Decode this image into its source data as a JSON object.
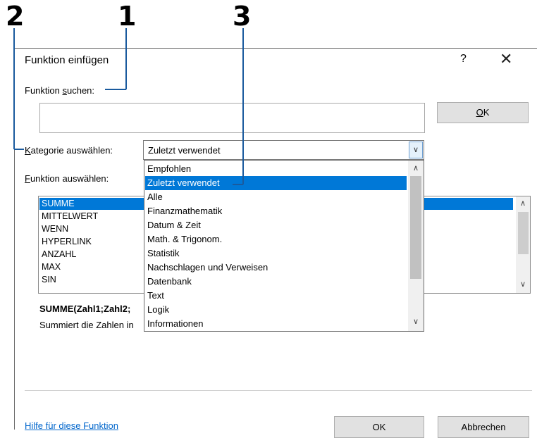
{
  "callouts": [
    "2",
    "1",
    "3"
  ],
  "dialog": {
    "title": "Funktion einfügen",
    "help": "?",
    "close": "✕"
  },
  "search": {
    "label_underlined": "s",
    "label_before": "Funktion ",
    "label_after": "uchen:",
    "value": "",
    "ok_label_underlined": "O",
    "ok_label_after": "K"
  },
  "category": {
    "label_underlined": "K",
    "label_after": "ategorie auswählen:",
    "selected": "Zuletzt verwendet",
    "options": [
      "Empfohlen",
      "Zuletzt verwendet",
      "Alle",
      "Finanzmathematik",
      "Datum & Zeit",
      "Math. & Trigonom.",
      "Statistik",
      "Nachschlagen und Verweisen",
      "Datenbank",
      "Text",
      "Logik",
      "Informationen"
    ],
    "highlighted_index": 1
  },
  "functions": {
    "label_underlined": "F",
    "label_after": "unktion auswählen:",
    "items": [
      "SUMME",
      "MITTELWERT",
      "WENN",
      "HYPERLINK",
      "ANZAHL",
      "MAX",
      "SIN"
    ],
    "selected_index": 0
  },
  "syntax": "SUMME(Zahl1;Zahl2;",
  "description": "Summiert die Zahlen in",
  "footer": {
    "help_link": "Hilfe für diese Funktion",
    "ok": "OK",
    "cancel": "Abbrechen"
  },
  "icons": {
    "dropdown": "chevron-down-icon",
    "scroll_up": "chevron-up-icon",
    "scroll_down": "chevron-down-icon"
  },
  "colors": {
    "selection": "#0078d7",
    "link": "#0066cc"
  }
}
